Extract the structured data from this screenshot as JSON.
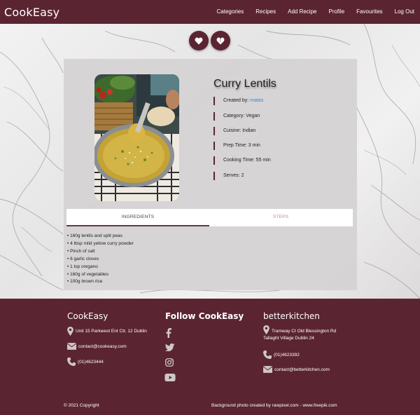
{
  "navbar": {
    "brand": "CookEasy",
    "links": [
      "Categories",
      "Recipes",
      "Add Recipe",
      "Profile",
      "Favourites",
      "Log Out"
    ]
  },
  "favourites": {
    "add_icon": "heart-icon",
    "remove_icon": "broken-heart-icon"
  },
  "recipe": {
    "title": "Curry Lentils",
    "created_by_label": "Created by:",
    "created_by_user": "matas",
    "category": "Category: Vegan",
    "cuisine": "Cuisine: Indian",
    "prep_time": "Prep Time: 3 min",
    "cooking_time": "Cooking Time: 55 min",
    "serves": "Serves: 2",
    "photo_icon": "recipe-photo"
  },
  "tabs": {
    "ingredients": "INGREDIENTS",
    "steps": "STEPS"
  },
  "ingredients": [
    "• 160g lentils and split peas",
    "• 4 tbsp mild yellow curry powder",
    "• Pinch of salt",
    "• 6 garlic cloves",
    "• 1 tsp oregano",
    "• 160g of vegetables",
    "• 100g brown rice"
  ],
  "footer": {
    "col1_title": "CookEasy",
    "col1_address": "Unit 15 Parkwest Ent Ctr, 12 Dublin",
    "col1_email": "contact@cookeasy.com",
    "col1_phone": "(01)4623444",
    "col2_title": "Follow CookEasy",
    "social_icons": [
      "facebook-icon",
      "twitter-icon",
      "instagram-icon",
      "youtube-icon"
    ],
    "col3_title": "betterkitchen",
    "col3_address_line1": "Tramway Ct Old Blessington Rd",
    "col3_address_line2": "Tallaght Village Dublin 24",
    "col3_phone": "(01)4623392",
    "col3_email": "contact@betterkitchen.com",
    "copyright": "© 2021 Copyright",
    "credit": "Background photo created by rawpixel.com - www.freepik.com"
  },
  "colors": {
    "brand": "#5b2431",
    "link": "#3b87d6",
    "steps_tab": "#b58a92"
  }
}
